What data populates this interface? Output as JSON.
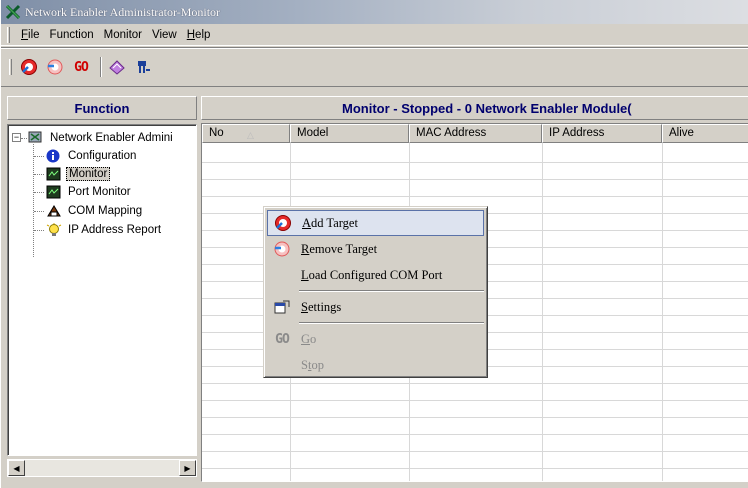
{
  "window": {
    "title": "Network Enabler Administrator-Monitor"
  },
  "menubar": {
    "items": [
      {
        "label": "File",
        "accel": "F",
        "rest": "ile"
      },
      {
        "label": "Function"
      },
      {
        "label": "Monitor"
      },
      {
        "label": "View"
      },
      {
        "label": "Help",
        "accel": "H",
        "rest": "elp"
      }
    ]
  },
  "toolbar": {
    "buttons": [
      "add-target-icon",
      "remove-target-icon",
      "go-icon",
      "settings-icon",
      "port-icon"
    ],
    "go_text": "GO"
  },
  "left_pane": {
    "header": "Function",
    "tree": {
      "root": "Network Enabler Admini",
      "children": [
        "Configuration",
        "Monitor",
        "Port Monitor",
        "COM Mapping",
        "IP Address Report"
      ],
      "selected": "Monitor"
    }
  },
  "right_pane": {
    "header": "Monitor - Stopped - 0 Network Enabler Module(",
    "columns": [
      "No",
      "Model",
      "MAC Address",
      "IP Address",
      "Alive"
    ],
    "sort_indicator": "△"
  },
  "context_menu": {
    "items": [
      {
        "label": "Add Target",
        "accel": "A",
        "rest": "dd Target",
        "icon": "add-target-icon",
        "highlighted": true,
        "enabled": true
      },
      {
        "label": "Remove Target",
        "accel": "R",
        "rest": "emove Target",
        "icon": "remove-target-icon",
        "enabled": true
      },
      {
        "label": "Load Configured COM Port",
        "accel": "L",
        "rest": "oad Configured COM Port",
        "icon": "",
        "enabled": true
      },
      {
        "label": "Settings",
        "accel": "S",
        "rest": "ettings",
        "icon": "settings-icon",
        "enabled": true
      },
      {
        "label": "Go",
        "accel": "G",
        "rest": "o",
        "icon": "go-icon",
        "enabled": false
      },
      {
        "label": "Stop",
        "accel": "t",
        "pre": "S",
        "rest": "op",
        "icon": "",
        "enabled": false
      }
    ],
    "go_text": "GO"
  },
  "colors": {
    "header_text": "#00006e",
    "go_red": "#d00000",
    "highlight_border": "#5a72a8"
  }
}
